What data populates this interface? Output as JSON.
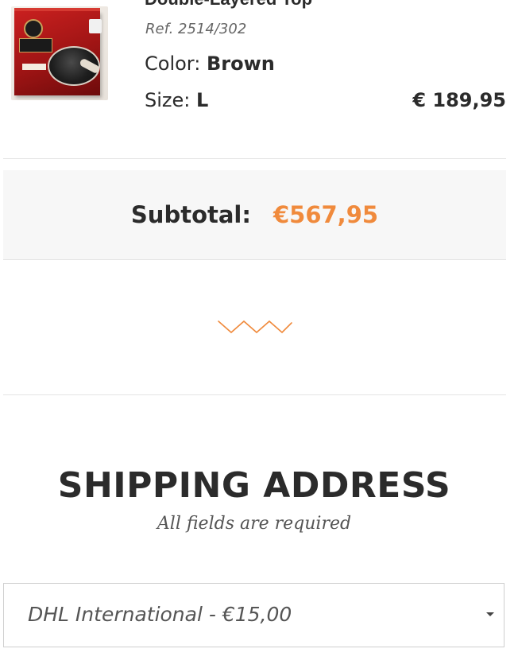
{
  "cart_item": {
    "title": "Double-Layered Top",
    "ref": "Ref. 2514/302",
    "color_label": "Color:",
    "color_value": "Brown",
    "size_label": "Size:",
    "size_value": "L",
    "price": "€ 189,95",
    "image": "product-box-image"
  },
  "subtotal": {
    "label": "Subtotal:",
    "value": "€567,95"
  },
  "divider_icon": "zigzag-icon",
  "shipping": {
    "title": "SHIPPING ADDRESS",
    "subtitle": "All fields are required",
    "method_value": "DHL International - €15,00",
    "method_icon": "caret-down-icon"
  },
  "colors": {
    "accent": "#f08a3c",
    "text": "#2b2b2b",
    "panel_bg": "#f7f7f7",
    "divider": "#e4e4e4"
  }
}
